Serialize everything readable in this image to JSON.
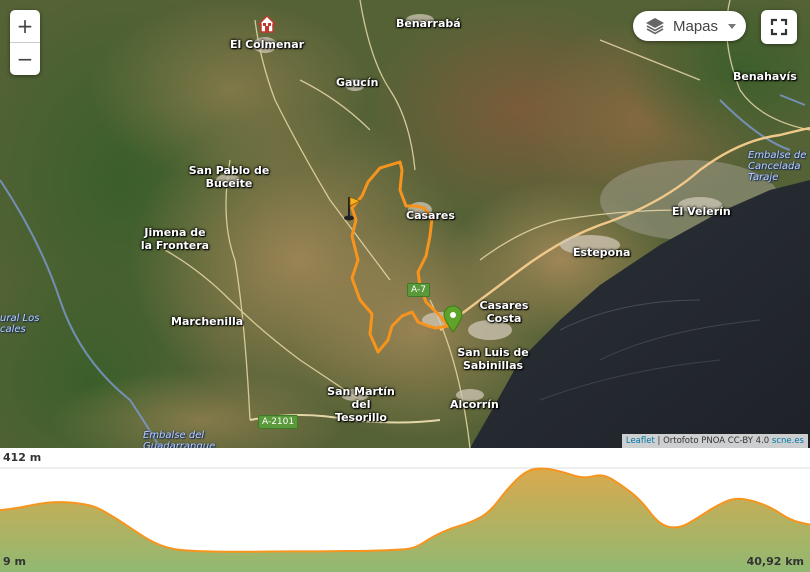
{
  "map": {
    "places": [
      {
        "id": "el-colmenar",
        "name": "El Colmenar"
      },
      {
        "id": "benarraba",
        "name": "Benarrabá"
      },
      {
        "id": "gaucin",
        "name": "Gaucín"
      },
      {
        "id": "benahavis",
        "name": "Benahavís"
      },
      {
        "id": "san-pablo",
        "name": "San Pablo de Buceite"
      },
      {
        "id": "jimena",
        "name": "Jimena de la Frontera"
      },
      {
        "id": "casares",
        "name": "Casares"
      },
      {
        "id": "el-velerin",
        "name": "El Velerín"
      },
      {
        "id": "estepona",
        "name": "Estepona"
      },
      {
        "id": "marchenilla",
        "name": "Marchenilla"
      },
      {
        "id": "casares-costa",
        "name": "Casares Costa"
      },
      {
        "id": "san-luis",
        "name": "San Luis de Sabinillas"
      },
      {
        "id": "san-martin",
        "name": "San Martín del Tesorillo"
      },
      {
        "id": "alcorrin",
        "name": "Alcorrín"
      }
    ],
    "water_labels": [
      {
        "id": "embalse-cancelada",
        "text": "Embalse de Cancelada Taraje"
      },
      {
        "id": "embalse-guadarranque",
        "text": "Embalse del Guadarranque"
      },
      {
        "id": "natural-los",
        "text": "ural Los cales"
      }
    ],
    "roads": [
      {
        "id": "a7",
        "label": "A-7"
      },
      {
        "id": "a2101",
        "label": "A-2101"
      }
    ],
    "controls": {
      "zoom_in": "+",
      "zoom_out": "−",
      "layers_label": "Mapas",
      "fullscreen_icon": "expand-icon"
    },
    "attribution": {
      "link": "Leaflet",
      "separator": " | ",
      "text": "Ortofoto PNOA CC-BY 4.0 ",
      "source": "scne.es"
    },
    "colors": {
      "route": "#f7941d",
      "start_marker": "#5fa32a",
      "finish_flag": "#f5b21f"
    }
  },
  "profile": {
    "max_elevation": "412 m",
    "min_elevation": "9 m",
    "total_distance": "40,92 km",
    "colors": {
      "line": "#f7941d",
      "fill_top": "#d7a544",
      "fill_bottom": "#8bb56a"
    },
    "elevation_series_m": [
      210,
      220,
      240,
      250,
      245,
      230,
      180,
      120,
      60,
      25,
      15,
      12,
      10,
      10,
      11,
      12,
      12,
      12,
      14,
      14,
      15,
      20,
      25,
      85,
      125,
      150,
      200,
      320,
      405,
      412,
      390,
      360,
      385,
      330,
      260,
      140,
      120,
      170,
      230,
      270,
      255,
      220,
      160,
      140
    ]
  }
}
